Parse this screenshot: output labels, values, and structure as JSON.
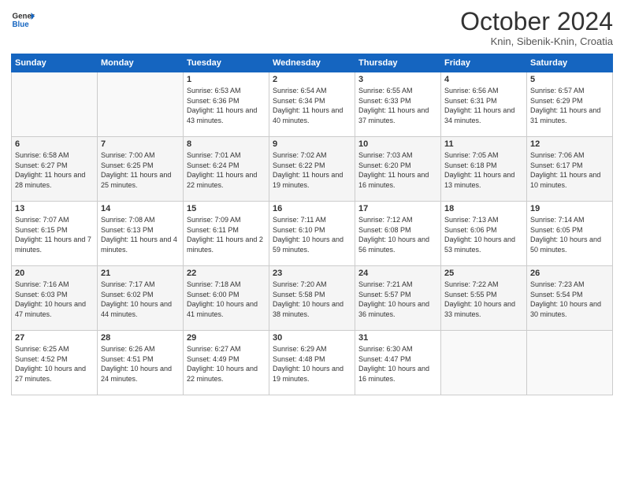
{
  "logo": {
    "general": "General",
    "blue": "Blue"
  },
  "header": {
    "month": "October 2024",
    "location": "Knin, Sibenik-Knin, Croatia"
  },
  "weekdays": [
    "Sunday",
    "Monday",
    "Tuesday",
    "Wednesday",
    "Thursday",
    "Friday",
    "Saturday"
  ],
  "weeks": [
    [
      {
        "day": "",
        "sunrise": "",
        "sunset": "",
        "daylight": ""
      },
      {
        "day": "",
        "sunrise": "",
        "sunset": "",
        "daylight": ""
      },
      {
        "day": "1",
        "sunrise": "Sunrise: 6:53 AM",
        "sunset": "Sunset: 6:36 PM",
        "daylight": "Daylight: 11 hours and 43 minutes."
      },
      {
        "day": "2",
        "sunrise": "Sunrise: 6:54 AM",
        "sunset": "Sunset: 6:34 PM",
        "daylight": "Daylight: 11 hours and 40 minutes."
      },
      {
        "day": "3",
        "sunrise": "Sunrise: 6:55 AM",
        "sunset": "Sunset: 6:33 PM",
        "daylight": "Daylight: 11 hours and 37 minutes."
      },
      {
        "day": "4",
        "sunrise": "Sunrise: 6:56 AM",
        "sunset": "Sunset: 6:31 PM",
        "daylight": "Daylight: 11 hours and 34 minutes."
      },
      {
        "day": "5",
        "sunrise": "Sunrise: 6:57 AM",
        "sunset": "Sunset: 6:29 PM",
        "daylight": "Daylight: 11 hours and 31 minutes."
      }
    ],
    [
      {
        "day": "6",
        "sunrise": "Sunrise: 6:58 AM",
        "sunset": "Sunset: 6:27 PM",
        "daylight": "Daylight: 11 hours and 28 minutes."
      },
      {
        "day": "7",
        "sunrise": "Sunrise: 7:00 AM",
        "sunset": "Sunset: 6:25 PM",
        "daylight": "Daylight: 11 hours and 25 minutes."
      },
      {
        "day": "8",
        "sunrise": "Sunrise: 7:01 AM",
        "sunset": "Sunset: 6:24 PM",
        "daylight": "Daylight: 11 hours and 22 minutes."
      },
      {
        "day": "9",
        "sunrise": "Sunrise: 7:02 AM",
        "sunset": "Sunset: 6:22 PM",
        "daylight": "Daylight: 11 hours and 19 minutes."
      },
      {
        "day": "10",
        "sunrise": "Sunrise: 7:03 AM",
        "sunset": "Sunset: 6:20 PM",
        "daylight": "Daylight: 11 hours and 16 minutes."
      },
      {
        "day": "11",
        "sunrise": "Sunrise: 7:05 AM",
        "sunset": "Sunset: 6:18 PM",
        "daylight": "Daylight: 11 hours and 13 minutes."
      },
      {
        "day": "12",
        "sunrise": "Sunrise: 7:06 AM",
        "sunset": "Sunset: 6:17 PM",
        "daylight": "Daylight: 11 hours and 10 minutes."
      }
    ],
    [
      {
        "day": "13",
        "sunrise": "Sunrise: 7:07 AM",
        "sunset": "Sunset: 6:15 PM",
        "daylight": "Daylight: 11 hours and 7 minutes."
      },
      {
        "day": "14",
        "sunrise": "Sunrise: 7:08 AM",
        "sunset": "Sunset: 6:13 PM",
        "daylight": "Daylight: 11 hours and 4 minutes."
      },
      {
        "day": "15",
        "sunrise": "Sunrise: 7:09 AM",
        "sunset": "Sunset: 6:11 PM",
        "daylight": "Daylight: 11 hours and 2 minutes."
      },
      {
        "day": "16",
        "sunrise": "Sunrise: 7:11 AM",
        "sunset": "Sunset: 6:10 PM",
        "daylight": "Daylight: 10 hours and 59 minutes."
      },
      {
        "day": "17",
        "sunrise": "Sunrise: 7:12 AM",
        "sunset": "Sunset: 6:08 PM",
        "daylight": "Daylight: 10 hours and 56 minutes."
      },
      {
        "day": "18",
        "sunrise": "Sunrise: 7:13 AM",
        "sunset": "Sunset: 6:06 PM",
        "daylight": "Daylight: 10 hours and 53 minutes."
      },
      {
        "day": "19",
        "sunrise": "Sunrise: 7:14 AM",
        "sunset": "Sunset: 6:05 PM",
        "daylight": "Daylight: 10 hours and 50 minutes."
      }
    ],
    [
      {
        "day": "20",
        "sunrise": "Sunrise: 7:16 AM",
        "sunset": "Sunset: 6:03 PM",
        "daylight": "Daylight: 10 hours and 47 minutes."
      },
      {
        "day": "21",
        "sunrise": "Sunrise: 7:17 AM",
        "sunset": "Sunset: 6:02 PM",
        "daylight": "Daylight: 10 hours and 44 minutes."
      },
      {
        "day": "22",
        "sunrise": "Sunrise: 7:18 AM",
        "sunset": "Sunset: 6:00 PM",
        "daylight": "Daylight: 10 hours and 41 minutes."
      },
      {
        "day": "23",
        "sunrise": "Sunrise: 7:20 AM",
        "sunset": "Sunset: 5:58 PM",
        "daylight": "Daylight: 10 hours and 38 minutes."
      },
      {
        "day": "24",
        "sunrise": "Sunrise: 7:21 AM",
        "sunset": "Sunset: 5:57 PM",
        "daylight": "Daylight: 10 hours and 36 minutes."
      },
      {
        "day": "25",
        "sunrise": "Sunrise: 7:22 AM",
        "sunset": "Sunset: 5:55 PM",
        "daylight": "Daylight: 10 hours and 33 minutes."
      },
      {
        "day": "26",
        "sunrise": "Sunrise: 7:23 AM",
        "sunset": "Sunset: 5:54 PM",
        "daylight": "Daylight: 10 hours and 30 minutes."
      }
    ],
    [
      {
        "day": "27",
        "sunrise": "Sunrise: 6:25 AM",
        "sunset": "Sunset: 4:52 PM",
        "daylight": "Daylight: 10 hours and 27 minutes."
      },
      {
        "day": "28",
        "sunrise": "Sunrise: 6:26 AM",
        "sunset": "Sunset: 4:51 PM",
        "daylight": "Daylight: 10 hours and 24 minutes."
      },
      {
        "day": "29",
        "sunrise": "Sunrise: 6:27 AM",
        "sunset": "Sunset: 4:49 PM",
        "daylight": "Daylight: 10 hours and 22 minutes."
      },
      {
        "day": "30",
        "sunrise": "Sunrise: 6:29 AM",
        "sunset": "Sunset: 4:48 PM",
        "daylight": "Daylight: 10 hours and 19 minutes."
      },
      {
        "day": "31",
        "sunrise": "Sunrise: 6:30 AM",
        "sunset": "Sunset: 4:47 PM",
        "daylight": "Daylight: 10 hours and 16 minutes."
      },
      {
        "day": "",
        "sunrise": "",
        "sunset": "",
        "daylight": ""
      },
      {
        "day": "",
        "sunrise": "",
        "sunset": "",
        "daylight": ""
      }
    ]
  ]
}
